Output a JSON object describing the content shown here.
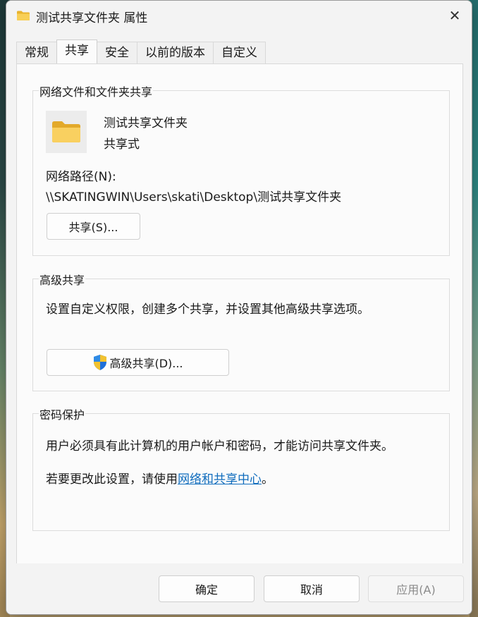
{
  "window": {
    "title": "测试共享文件夹 属性",
    "close_glyph": "✕"
  },
  "tabs": [
    {
      "label": "常规"
    },
    {
      "label": "共享"
    },
    {
      "label": "安全"
    },
    {
      "label": "以前的版本"
    },
    {
      "label": "自定义"
    }
  ],
  "active_tab": "共享",
  "network_sharing": {
    "legend": "网络文件和文件夹共享",
    "folder_name": "测试共享文件夹",
    "share_state": "共享式",
    "path_label": "网络路径(N):",
    "path_value": "\\\\SKATINGWIN\\Users\\skati\\Desktop\\测试共享文件夹",
    "share_button": "共享(S)..."
  },
  "advanced_sharing": {
    "legend": "高级共享",
    "description": "设置自定义权限，创建多个共享，并设置其他高级共享选项。",
    "button": "高级共享(D)..."
  },
  "password_protection": {
    "legend": "密码保护",
    "line1": "用户必须具有此计算机的用户帐户和密码，才能访问共享文件夹。",
    "line2_prefix": "若要更改此设置，请使用",
    "line2_link": "网络和共享中心",
    "line2_suffix": "。"
  },
  "footer": {
    "ok": "确定",
    "cancel": "取消",
    "apply": "应用(A)"
  },
  "colors": {
    "folder": "#f5c542",
    "link": "#0f6cbd",
    "shield_blue": "#1e6fd9",
    "shield_yellow": "#f2c230"
  }
}
